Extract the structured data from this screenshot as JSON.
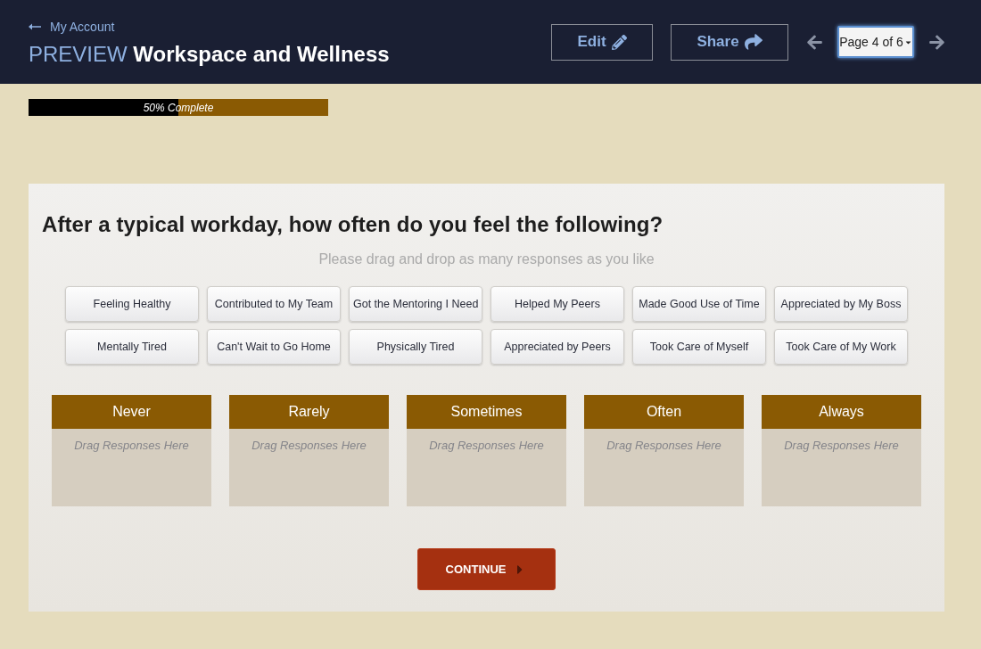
{
  "header": {
    "back_link": {
      "label": "My Account"
    },
    "title_prefix": "PREVIEW",
    "title": "Workspace and Wellness",
    "buttons": [
      {
        "label": "Edit",
        "kind": "edit"
      },
      {
        "label": "Share",
        "kind": "share"
      }
    ],
    "page_select": {
      "value": "Page 4 of 6"
    }
  },
  "progress": {
    "level": 0.5,
    "label": "50% Complete"
  },
  "question": {
    "title": "After a typical workday, how often do you feel the following?",
    "instruction": "Please drag and drop as many responses as you like",
    "responses": [
      "Feeling Healthy",
      "Contributed to My Team",
      "Got the Mentoring I Need",
      "Helped My Peers",
      "Made Good Use of Time",
      "Appreciated by My Boss",
      "Mentally Tired",
      "Can't Wait to Go Home",
      "Physically Tired",
      "Appreciated by Peers",
      "Took Care of Myself",
      "Took Care of My Work"
    ],
    "bins": [
      {
        "label": "Never",
        "placeholder": "Drag Responses Here"
      },
      {
        "label": "Rarely",
        "placeholder": "Drag Responses Here"
      },
      {
        "label": "Sometimes",
        "placeholder": "Drag Responses Here"
      },
      {
        "label": "Often",
        "placeholder": "Drag Responses Here"
      },
      {
        "label": "Always",
        "placeholder": "Drag Responses Here"
      }
    ]
  },
  "continue_button": {
    "label": "CONTINUE"
  }
}
